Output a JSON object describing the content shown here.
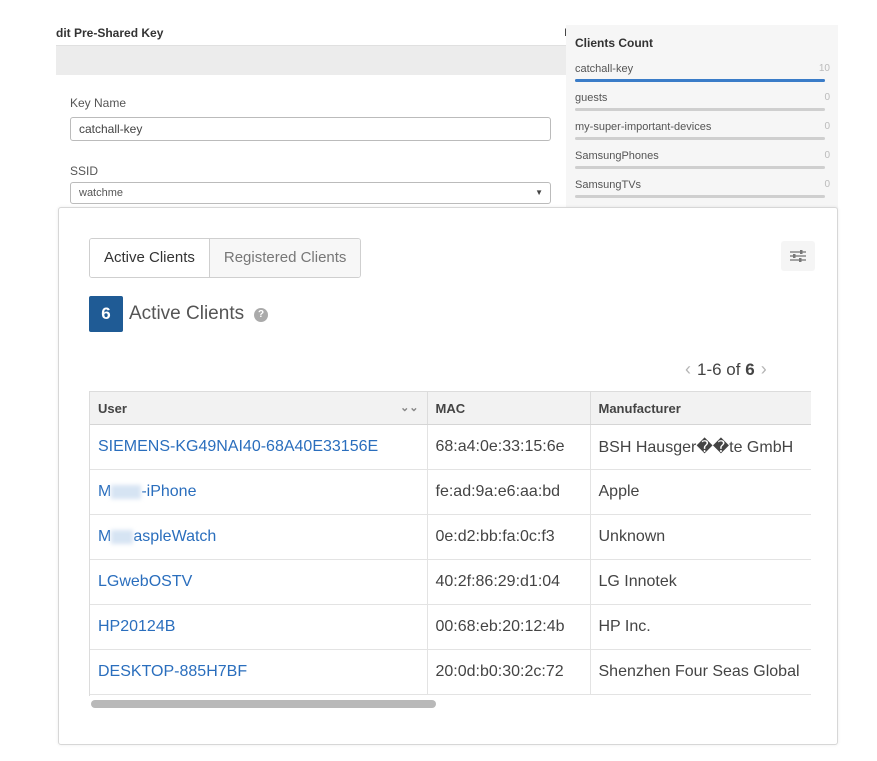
{
  "psk_form": {
    "title": "dit Pre-Shared Key",
    "close_mark": "I",
    "key_name_label": "Key Name",
    "key_name_value": "catchall-key",
    "ssid_label": "SSID",
    "ssid_value": "watchme"
  },
  "clients_count": {
    "title": "Clients Count",
    "items": [
      {
        "label": "catchall-key",
        "count": "10",
        "fill": 1.0
      },
      {
        "label": "guests",
        "count": "0",
        "fill": 0
      },
      {
        "label": "my-super-important-devices",
        "count": "0",
        "fill": 0
      },
      {
        "label": "SamsungPhones",
        "count": "0",
        "fill": 0
      },
      {
        "label": "SamsungTVs",
        "count": "0",
        "fill": 0
      }
    ]
  },
  "tabs": [
    {
      "label": "Active Clients",
      "active": true
    },
    {
      "label": "Registered Clients",
      "active": false
    }
  ],
  "active_count": {
    "number": "6",
    "label": "Active Clients",
    "help": "?"
  },
  "pager": {
    "prev": "‹",
    "range": "1-6 of",
    "total": "6",
    "next": "›"
  },
  "table": {
    "columns": [
      "User",
      "MAC",
      "Manufacturer"
    ],
    "rows": [
      {
        "user": "SIEMENS-KG49NAI40-68A40E33156E",
        "mac": "68:a4:0e:33:15:6e",
        "manufacturer": "BSH Hausger��te GmbH"
      },
      {
        "user_prefix": "M",
        "user_suffix": "-iPhone",
        "mac": "fe:ad:9a:e6:aa:bd",
        "manufacturer": "Apple"
      },
      {
        "user_prefix": "M",
        "user_suffix": "aspleWatch",
        "mac": "0e:d2:bb:fa:0c:f3",
        "manufacturer": "Unknown"
      },
      {
        "user": "LGwebOSTV",
        "mac": "40:2f:86:29:d1:04",
        "manufacturer": "LG Innotek"
      },
      {
        "user": "HP20124B",
        "mac": "00:68:eb:20:12:4b",
        "manufacturer": "HP Inc."
      },
      {
        "user": "DESKTOP-885H7BF",
        "mac": "20:0d:b0:30:2c:72",
        "manufacturer": "Shenzhen Four Seas Global"
      }
    ]
  },
  "colors": {
    "accent": "#1f5b95",
    "link": "#2a6ebd",
    "bar_fill": "#3a7cc8"
  },
  "scroll": {
    "thumb_fraction": 0.48
  }
}
